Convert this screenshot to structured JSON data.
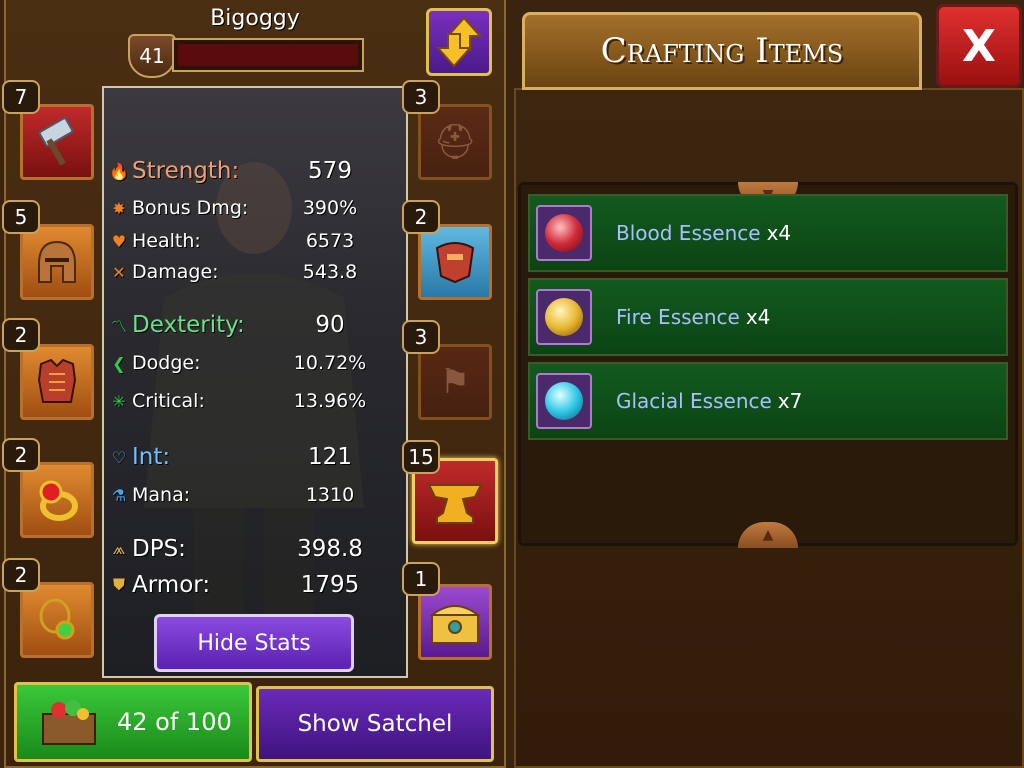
{
  "character": {
    "name": "Bigoggy",
    "level": "41",
    "xp_fraction": 0.0
  },
  "stats": {
    "strength": {
      "label": "Strength:",
      "value": "579"
    },
    "bonus_dmg": {
      "label": "Bonus Dmg:",
      "value": "390%"
    },
    "health": {
      "label": "Health:",
      "value": "6573"
    },
    "damage": {
      "label": "Damage:",
      "value": "543.8"
    },
    "dexterity": {
      "label": "Dexterity:",
      "value": "90"
    },
    "dodge": {
      "label": "Dodge:",
      "value": "10.72%"
    },
    "critical": {
      "label": "Critical:",
      "value": "13.96%"
    },
    "int": {
      "label": "Int:",
      "value": "121"
    },
    "mana": {
      "label": "Mana:",
      "value": "1310"
    },
    "dps": {
      "label": "DPS:",
      "value": "398.8"
    },
    "armor": {
      "label": "Armor:",
      "value": "1795"
    },
    "hide_button": "Hide Stats"
  },
  "equipment_left": [
    {
      "name": "hammer",
      "count": "7",
      "icon": "hammer-icon"
    },
    {
      "name": "helmet",
      "count": "5",
      "icon": "helmet-icon"
    },
    {
      "name": "chest-armor",
      "count": "2",
      "icon": "chest-armor-icon"
    },
    {
      "name": "ring",
      "count": "2",
      "icon": "ring-icon"
    },
    {
      "name": "amulet",
      "count": "2",
      "icon": "amulet-icon"
    }
  ],
  "equipment_right": [
    {
      "name": "helm-slot",
      "count": "3",
      "icon": "helm-slot-icon"
    },
    {
      "name": "shoulder-armor",
      "count": "2",
      "icon": "shoulder-armor-icon"
    },
    {
      "name": "banner-slot",
      "count": "3",
      "icon": "banner-icon"
    },
    {
      "name": "anvil",
      "count": "15",
      "icon": "anvil-icon"
    },
    {
      "name": "chest",
      "count": "1",
      "icon": "treasure-chest-icon"
    }
  ],
  "satchel": {
    "count_text": "42 of 100",
    "show_label": "Show Satchel"
  },
  "crafting": {
    "title": "Crafting Items",
    "close_label": "X",
    "items": [
      {
        "name": "Blood Essence",
        "qty": "x4",
        "color": "#d02a3a"
      },
      {
        "name": "Fire Essence",
        "qty": "x4",
        "color": "#e8b830"
      },
      {
        "name": "Glacial Essence",
        "qty": "x7",
        "color": "#30c8e8"
      }
    ]
  },
  "colors": {
    "item_name": "#a8c0ff",
    "item_row_bg": "#125a1e",
    "frame_gold": "#e0c24a"
  }
}
